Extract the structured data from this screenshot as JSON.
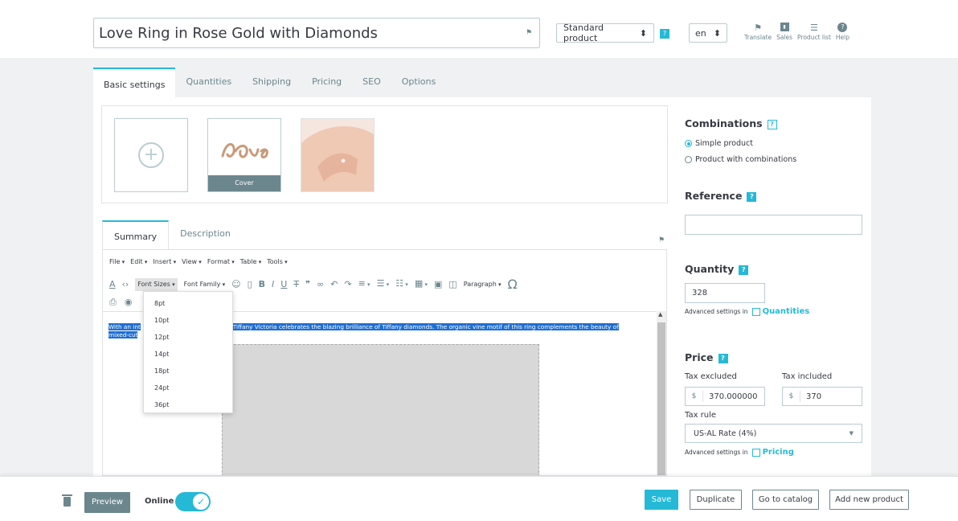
{
  "header": {
    "product_name": "Love Ring in Rose Gold with Diamonds",
    "product_type": "Standard product",
    "language": "en",
    "links": [
      {
        "label": "Translate",
        "icon": "translate-icon"
      },
      {
        "label": "Sales",
        "icon": "sales-icon"
      },
      {
        "label": "Product list",
        "icon": "list-icon"
      },
      {
        "label": "Help",
        "icon": "help-icon"
      }
    ]
  },
  "tabs": [
    "Basic settings",
    "Quantities",
    "Shipping",
    "Pricing",
    "SEO",
    "Options"
  ],
  "images": {
    "cover_label": "Cover"
  },
  "editor": {
    "tabs": [
      "Summary",
      "Description"
    ],
    "menu": [
      "File",
      "Edit",
      "Insert",
      "View",
      "Format",
      "Table",
      "Tools"
    ],
    "font_sizes_label": "Font Sizes",
    "font_family_label": "Font Family",
    "paragraph_label": "Paragraph",
    "font_sizes": [
      "8pt",
      "10pt",
      "12pt",
      "14pt",
      "18pt",
      "24pt",
      "36pt"
    ],
    "content_line1_start": "With an int",
    "content_line1_end": "y, Tiffany Victoria celebrates the blazing brilliance of Tiffany diamonds. The organic vine motif of this ring complements the beauty of",
    "content_line2": "mixed-cut"
  },
  "combinations": {
    "title": "Combinations",
    "options": [
      "Simple product",
      "Product with combinations"
    ],
    "selected": "Simple product"
  },
  "reference": {
    "title": "Reference",
    "value": ""
  },
  "quantity": {
    "title": "Quantity",
    "value": "328",
    "advanced_text": "Advanced settings in",
    "advanced_link": "Quantities"
  },
  "price": {
    "title": "Price",
    "tax_excluded_label": "Tax excluded",
    "tax_included_label": "Tax included",
    "currency": "$",
    "tax_excluded_value": "370.000000",
    "tax_included_value": "370",
    "tax_rule_label": "Tax rule",
    "tax_rule_value": "US-AL Rate (4%)",
    "advanced_text": "Advanced settings in",
    "advanced_link": "Pricing"
  },
  "footer": {
    "preview": "Preview",
    "online": "Online",
    "online_state": true,
    "save": "Save",
    "duplicate": "Duplicate",
    "go_to_catalog": "Go to catalog",
    "add_new_product": "Add new product"
  },
  "colors": {
    "accent": "#25b9d7",
    "muted": "#6c868e",
    "text": "#363a41",
    "selection": "#1f6fd1"
  }
}
